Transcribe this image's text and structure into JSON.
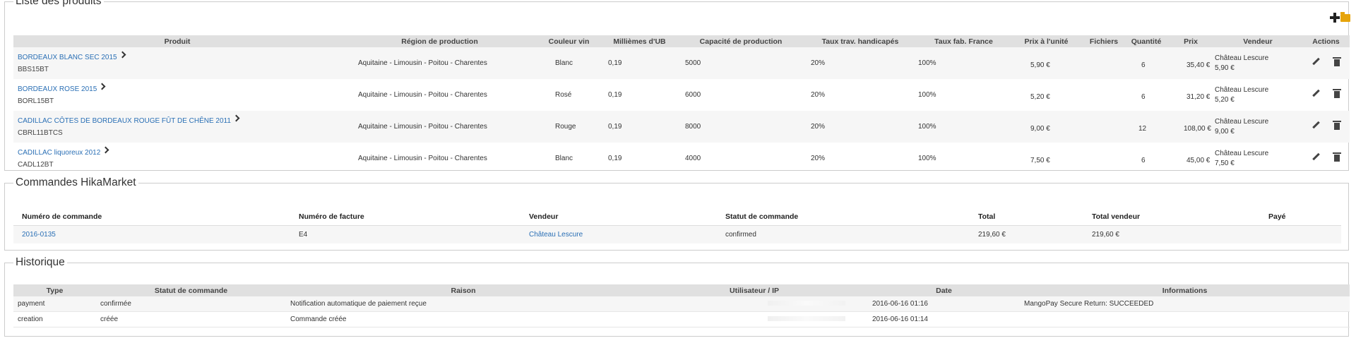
{
  "products": {
    "legend": "Liste des produits",
    "toolbar": {
      "add_icon": "plus-icon",
      "folder_icon": "folder-icon"
    },
    "headers": [
      "Produit",
      "Région de production",
      "Couleur vin",
      "Millièmes d'UB",
      "Capacité de production",
      "Taux trav. handicapés",
      "Taux fab. France",
      "Prix à l'unité",
      "Fichiers",
      "Quantité",
      "Prix",
      "Vendeur",
      "Actions"
    ],
    "rows": [
      {
        "name": "BORDEAUX BLANC SEC 2015",
        "sku": "BBS15BT",
        "region": "Aquitaine - Limousin - Poitou - Charentes",
        "color": "Blanc",
        "ub": "0,19",
        "capacity": "5000",
        "handicap": "20%",
        "france": "100%",
        "unit_price": "5,90 €",
        "files": "",
        "quantity": "6",
        "price": "35,40 €",
        "vendor": "Château Lescure",
        "vendor_price": "5,90 €"
      },
      {
        "name": "BORDEAUX ROSE 2015",
        "sku": "BORL15BT",
        "region": "Aquitaine - Limousin - Poitou - Charentes",
        "color": "Rosé",
        "ub": "0,19",
        "capacity": "6000",
        "handicap": "20%",
        "france": "100%",
        "unit_price": "5,20 €",
        "files": "",
        "quantity": "6",
        "price": "31,20 €",
        "vendor": "Château Lescure",
        "vendor_price": "5,20 €"
      },
      {
        "name": "CADILLAC CÔTES DE BORDEAUX ROUGE FÛT DE CHÊNE 2011",
        "sku": "CBRL11BTCS",
        "region": "Aquitaine - Limousin - Poitou - Charentes",
        "color": "Rouge",
        "ub": "0,19",
        "capacity": "8000",
        "handicap": "20%",
        "france": "100%",
        "unit_price": "9,00 €",
        "files": "",
        "quantity": "12",
        "price": "108,00 €",
        "vendor": "Château Lescure",
        "vendor_price": "9,00 €"
      },
      {
        "name": "CADILLAC liquoreux 2012",
        "sku": "CADL12BT",
        "region": "Aquitaine - Limousin - Poitou - Charentes",
        "color": "Blanc",
        "ub": "0,19",
        "capacity": "4000",
        "handicap": "20%",
        "france": "100%",
        "unit_price": "7,50 €",
        "files": "",
        "quantity": "6",
        "price": "45,00 €",
        "vendor": "Château Lescure",
        "vendor_price": "7,50 €"
      }
    ]
  },
  "orders": {
    "legend": "Commandes HikaMarket",
    "headers": [
      "Numéro de commande",
      "Numéro de facture",
      "Vendeur",
      "Statut de commande",
      "Total",
      "Total vendeur",
      "Payé"
    ],
    "rows": [
      {
        "number": "2016-0135",
        "invoice": "E4",
        "vendor": "Château Lescure",
        "status": "confirmed",
        "total": "219,60 €",
        "vendor_total": "219,60 €",
        "paid": ""
      }
    ]
  },
  "history": {
    "legend": "Historique",
    "headers": [
      "Type",
      "Statut de commande",
      "Raison",
      "Utilisateur / IP",
      "Date",
      "Informations"
    ],
    "rows": [
      {
        "type": "payment",
        "status": "confirmée",
        "reason": "Notification automatique de paiement reçue",
        "user": "",
        "date": "2016-06-16 01:16",
        "info": "MangoPay Secure Return: SUCCEEDED"
      },
      {
        "type": "creation",
        "status": "créée",
        "reason": "Commande créée",
        "user": "",
        "date": "2016-06-16 01:14",
        "info": ""
      }
    ]
  }
}
